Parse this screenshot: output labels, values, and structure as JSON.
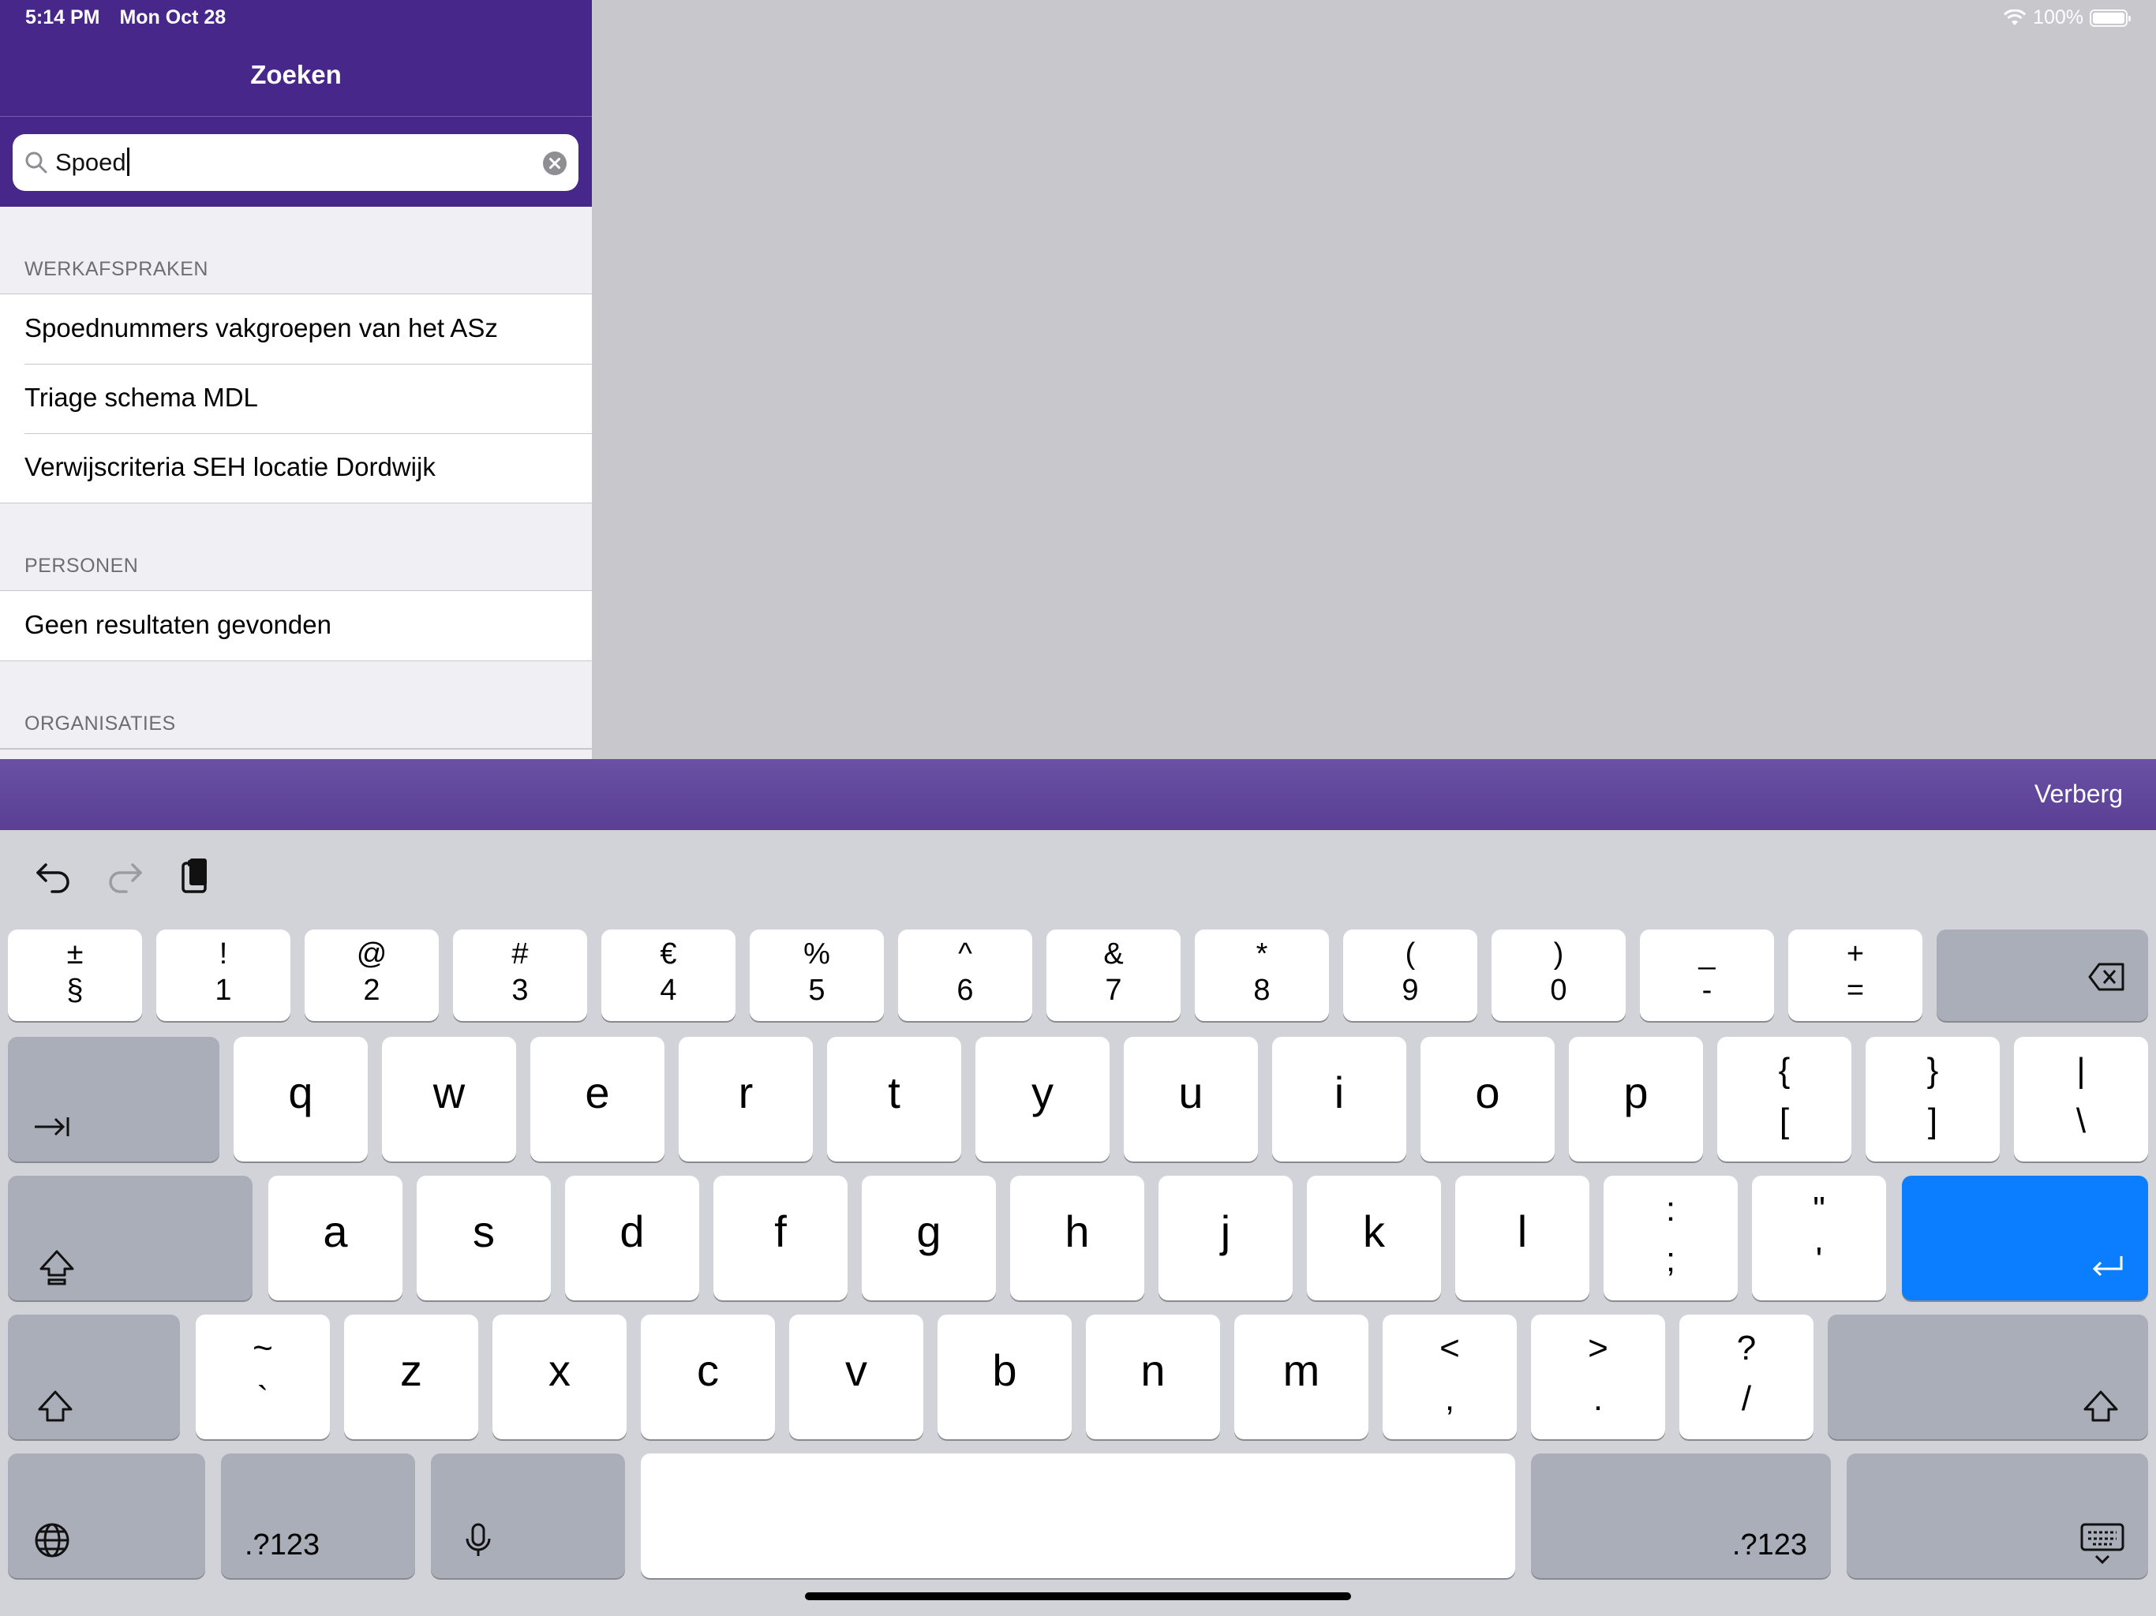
{
  "status": {
    "time": "5:14 PM",
    "date": "Mon Oct 28",
    "battery": "100%"
  },
  "nav": {
    "title": "Zoeken"
  },
  "search": {
    "value": "Spoed"
  },
  "sections": [
    {
      "header": "WERKAFSPRAKEN",
      "rows": [
        "Spoednummers vakgroepen van het ASz",
        "Triage schema MDL",
        "Verwijscriteria SEH locatie Dordwijk"
      ]
    },
    {
      "header": "PERSONEN",
      "rows": [
        "Geen resultaten gevonden"
      ]
    },
    {
      "header": "ORGANISATIES",
      "rows": []
    }
  ],
  "accessory": {
    "hide_label": "Verberg"
  },
  "keyboard": {
    "number_row": [
      [
        "±",
        "§"
      ],
      [
        "!",
        "1"
      ],
      [
        "@",
        "2"
      ],
      [
        "#",
        "3"
      ],
      [
        "€",
        "4"
      ],
      [
        "%",
        "5"
      ],
      [
        "^",
        "6"
      ],
      [
        "&",
        "7"
      ],
      [
        "*",
        "8"
      ],
      [
        "(",
        "9"
      ],
      [
        ")",
        "0"
      ],
      [
        "_",
        "-"
      ],
      [
        "+",
        "="
      ]
    ],
    "row_q": [
      "q",
      "w",
      "e",
      "r",
      "t",
      "y",
      "u",
      "i",
      "o",
      "p"
    ],
    "row_q_sym": [
      [
        "{",
        "["
      ],
      [
        "}",
        "]"
      ],
      [
        "|",
        "\\"
      ]
    ],
    "row_a": [
      "a",
      "s",
      "d",
      "f",
      "g",
      "h",
      "j",
      "k",
      "l"
    ],
    "row_a_sym": [
      [
        ":",
        ";"
      ],
      [
        "\"",
        "'"
      ]
    ],
    "row_z_sym_first": [
      "~",
      "`"
    ],
    "row_z": [
      "z",
      "x",
      "c",
      "v",
      "b",
      "n",
      "m"
    ],
    "row_z_sym": [
      [
        "<",
        ","
      ],
      [
        ">",
        "."
      ],
      [
        "?",
        "/"
      ]
    ],
    "numbers_label": ".?123"
  }
}
